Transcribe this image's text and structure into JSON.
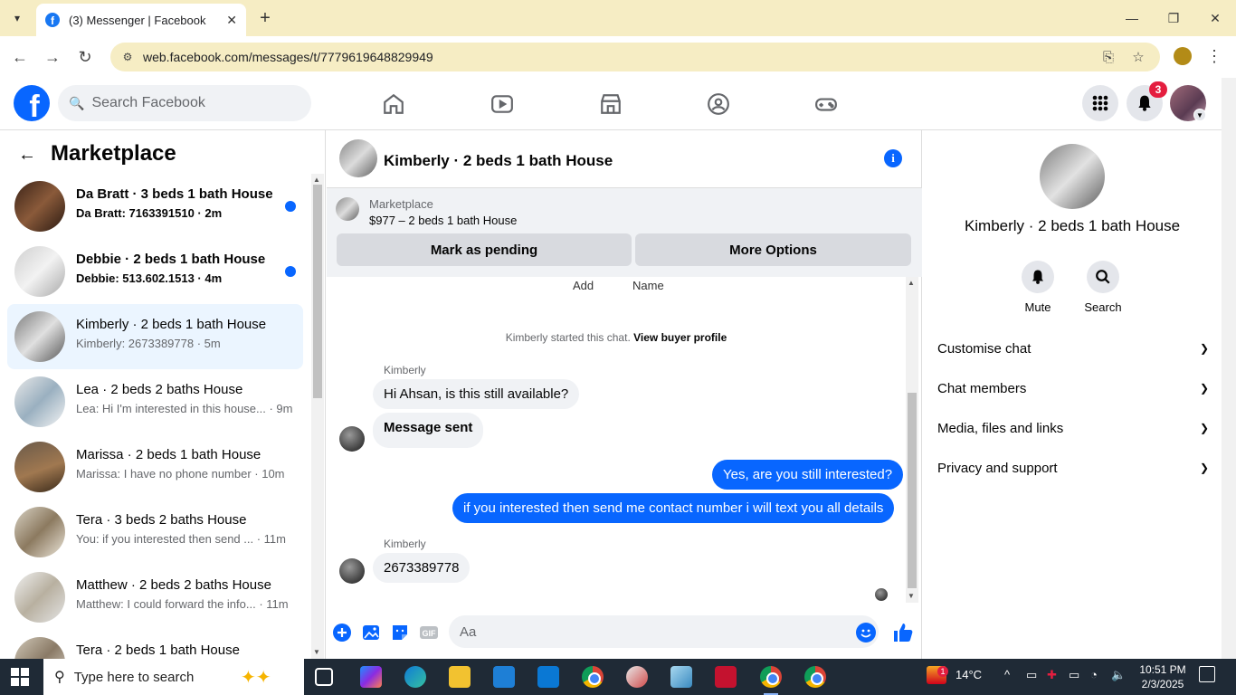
{
  "browser": {
    "tab_title": "(3) Messenger | Facebook",
    "favicon": "f",
    "url": "web.facebook.com/messages/t/7779619648829949"
  },
  "fb": {
    "logo": "f",
    "search_placeholder": "Search Facebook",
    "notification_count": "3"
  },
  "sidebar": {
    "title": "Marketplace",
    "conversations": [
      {
        "name": "Da Bratt · 3 beds 1 bath House",
        "snippet": "Da Bratt: 7163391510 · 2m",
        "unread": true
      },
      {
        "name": "Debbie · 2 beds 1 bath House",
        "snippet": "Debbie: 513.602.1513 · 4m",
        "unread": true
      },
      {
        "name": "Kimberly · 2 beds 1 bath House",
        "snippet": "Kimberly: 2673389778 · 5m",
        "unread": false
      },
      {
        "name": "Lea · 2 beds 2 baths House",
        "snippet": "Lea: Hi I'm interested in this house... · 9m",
        "unread": false
      },
      {
        "name": "Marissa · 2 beds 1 bath House",
        "snippet": "Marissa: I have no phone number · 10m",
        "unread": false
      },
      {
        "name": "Tera · 3 beds 2 baths House",
        "snippet": "You: if you interested then send ... · 11m",
        "unread": false
      },
      {
        "name": "Matthew · 2 beds 2 baths House",
        "snippet": "Matthew: I could forward the info... · 11m",
        "unread": false
      },
      {
        "name": "Tera · 2 beds 1 bath House",
        "snippet": "",
        "unread": false
      }
    ]
  },
  "conversation": {
    "title": "Kimberly · 2 beds 1 bath House",
    "listing_category": "Marketplace",
    "listing_price": "$977 – 2 beds 1 bath House",
    "mark_pending_label": "Mark as pending",
    "more_options_label": "More Options",
    "add_label": "Add",
    "name_label": "Name",
    "started_text": "Kimberly started this chat.",
    "view_profile_label": "View buyer profile",
    "sender_name_1": "Kimberly",
    "msg_in_1": "Hi Ahsan, is this still available?",
    "msg_in_2": "Message sent",
    "msg_out_1": "Yes, are you still interested?",
    "msg_out_2": "if you interested then send me contact number i will text you all details",
    "sender_name_2": "Kimberly",
    "msg_in_3": "2673389778",
    "composer_placeholder": "Aa"
  },
  "details": {
    "name": "Kimberly · 2 beds 1 bath House",
    "mute_label": "Mute",
    "search_label": "Search",
    "sections": [
      "Customise chat",
      "Chat members",
      "Media, files and links",
      "Privacy and support"
    ]
  },
  "taskbar": {
    "search_placeholder": "Type here to search",
    "temperature": "14°C",
    "weather_badge": "1",
    "time": "10:51 PM",
    "date": "2/3/2025"
  },
  "colors": {
    "fb_blue": "#0866ff",
    "chrome_tab_bg": "#f6edc4",
    "active_row": "#ebf5ff",
    "badge_red": "#e41e3f"
  }
}
